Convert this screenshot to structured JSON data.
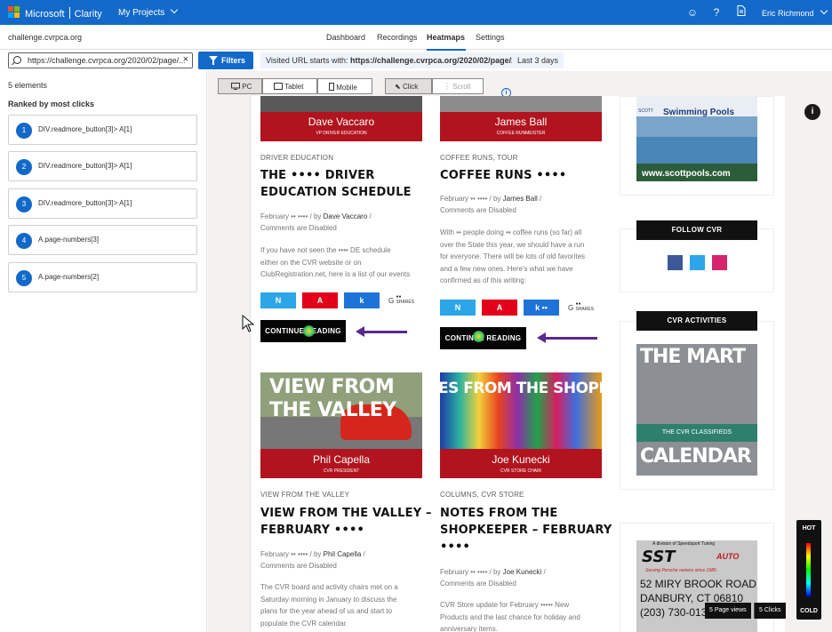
{
  "topbar": {
    "brand": "Microsoft",
    "product": "Clarity",
    "projects": "My Projects",
    "user": "Eric Richmond",
    "icons": [
      "smiley-icon",
      "help-icon",
      "document-icon"
    ]
  },
  "nav": {
    "site": "challenge.cvrpca.org",
    "tabs": [
      "Dashboard",
      "Recordings",
      "Heatmaps",
      "Settings"
    ],
    "active": "Heatmaps"
  },
  "filters": {
    "url": "https://challenge.cvrpca.org/2020/02/page/...",
    "button": "Filters",
    "chip_prefix": "Visited URL starts with:",
    "chip_value": "https://challenge.cvrpca.org/2020/02/page/2/*",
    "date": "Last 3 days"
  },
  "sidebar": {
    "count": "5 elements",
    "title": "Ranked by most clicks",
    "items": [
      {
        "num": "1",
        "label": "DIV.readmore_button[3]> A[1]"
      },
      {
        "num": "2",
        "label": "DIV.readmore_button[3]> A[1]"
      },
      {
        "num": "3",
        "label": "DIV.readmore_button[3]> A[1]"
      },
      {
        "num": "4",
        "label": "A.page-numbers[3]"
      },
      {
        "num": "5",
        "label": "A.page-numbers[2]"
      }
    ]
  },
  "devices": {
    "pc": "PC",
    "tablet": "Tablet",
    "mobile": "Mobile",
    "click": "Click",
    "scroll": "Scroll"
  },
  "posts": [
    {
      "caption_name": "Dave Vaccaro",
      "caption_role": "VP DRIVER EDUCATION",
      "cat": "DRIVER EDUCATION",
      "title1": "THE •••• DRIVER",
      "title2": "EDUCATION SCHEDULE",
      "date": "February •• ••••",
      "by": "by",
      "author": "Dave Vaccaro",
      "comments": "Comments are Disabled",
      "excerpt": [
        "If you have not seen the •••• DE schedule",
        "either on the CVR website or on",
        "ClubRegistration.net, here is a list of our events"
      ],
      "share": [
        "N",
        "A",
        "k"
      ],
      "g": "G",
      "shares": "SHARES",
      "cont": "CONTINUE READING"
    },
    {
      "caption_name": "James Ball",
      "caption_role": "COFFEE RUNMEISTER",
      "cat": "COFFEE RUNS, TOUR",
      "title1": "COFFEE RUNS ••••",
      "date": "February •• ••••",
      "by": "by",
      "author": "James Ball",
      "comments": "Comments are Disabled",
      "excerpt": [
        "With •• people doing •• coffee runs (so far) all",
        "over the State this year, we should have a run",
        "for everyone. There will be lots of old favorites",
        "and a few new ones. Here's what we have",
        "confirmed as of this writing:"
      ],
      "share": [
        "N",
        "A",
        "k ••"
      ],
      "g": "G",
      "shares": "SHARES",
      "cont": "CONTINUE READING"
    },
    {
      "img_text1": "VIEW FROM",
      "img_text2": "THE VALLEY",
      "caption_name": "Phil Capella",
      "caption_role": "CVR PRESIDENT",
      "cat": "VIEW FROM THE VALLEY",
      "title1": "VIEW FROM THE VALLEY –",
      "title2": "FEBRUARY ••••",
      "date": "February •• ••••",
      "by": "by",
      "author": "Phil Capella",
      "comments": "Comments are Disabled",
      "excerpt": [
        "The CVR board and activity chairs met on a",
        "Saturday morning in January to discuss the",
        "plans for the year ahead of us and start to",
        "populate the CVR calendar."
      ]
    },
    {
      "img_text1": "ES FROM THE SHOPKE",
      "caption_name": "Joe Kunecki",
      "caption_role": "CVR STORE CHAIR",
      "cat": "COLUMNS, CVR STORE",
      "title1": "NOTES FROM THE",
      "title2": "SHOPKEEPER – FEBRUARY",
      "title3": "••••",
      "date": "February •• ••••",
      "by": "by",
      "author": "Joe Kunecki",
      "comments": "Comments are Disabled",
      "excerpt": [
        "CVR Store update for February ••••• New",
        "Products and the last chance for holiday and",
        "anniversary items."
      ]
    }
  ],
  "right": {
    "pool_scott": "SCOTT",
    "pool_text": "Swimming Pools",
    "pool_url": "www.scottpools.com",
    "follow": "FOLLOW CVR",
    "activities": "CVR ACTIVITIES",
    "mart1": "THE MART",
    "mart2": "THE CVR CLASSIFIEDS",
    "mart3": "CALENDAR",
    "sst_top": "A division of Speedsport Tuning",
    "sst_logo": "SST",
    "sst_auto": "AUTO",
    "sst_tag": "Serving Porsche owners since 1985",
    "sst_addr1": "52 MIRY BROOK ROAD",
    "sst_addr2": "DANBURY, CT 06810",
    "sst_phone": "(203) 730-0131"
  },
  "heat": {
    "hot": "HOT",
    "cold": "COLD"
  },
  "stats": {
    "views": "5 Page views",
    "clicks": "5 Clicks"
  },
  "colors": {
    "accent": "#1369c9",
    "twitter": "#2ca6e8",
    "pinterest": "#e3001b",
    "linkedin": "#1e73d9"
  }
}
